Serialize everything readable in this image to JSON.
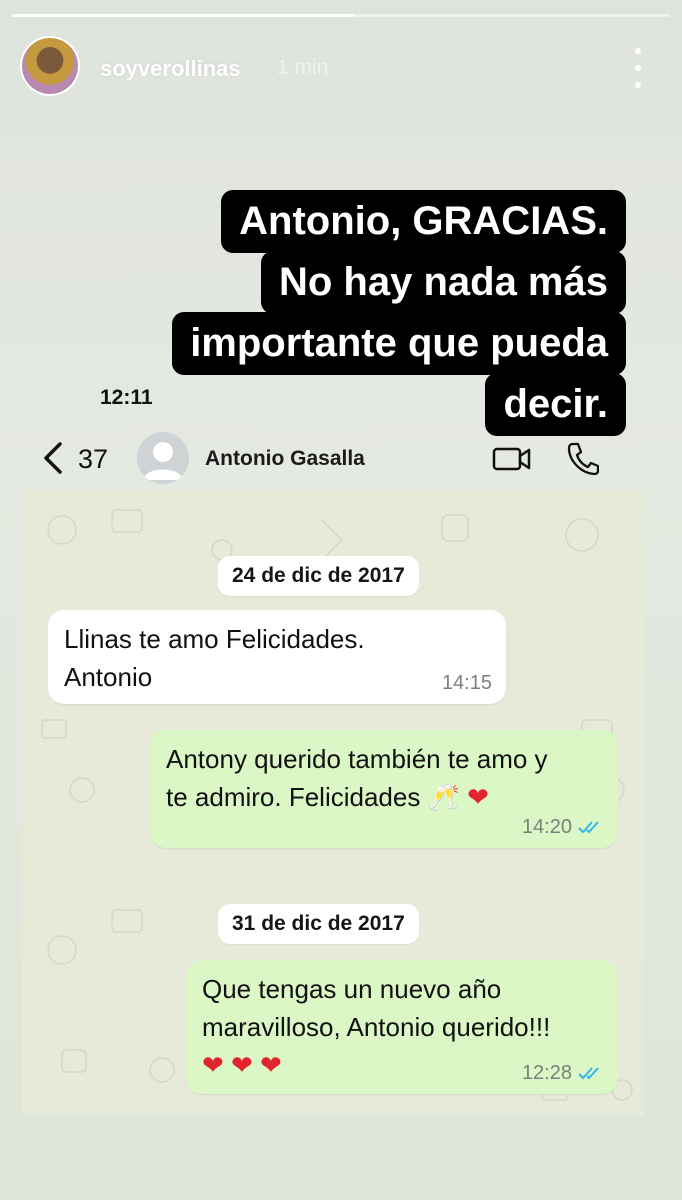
{
  "story": {
    "username": "soyverollinas",
    "time_ago": "1 min",
    "progress": 0.52
  },
  "caption": {
    "lines": [
      "Antonio, GRACIAS.",
      "No hay nada más",
      "importante que pueda",
      "decir."
    ]
  },
  "status_bar": {
    "clock": "12:11"
  },
  "chat_header": {
    "back_count": "37",
    "contact_name": "Antonio Gasalla",
    "icons": [
      "chevron-left-icon",
      "video-call-icon",
      "phone-icon"
    ]
  },
  "chat": {
    "date1": "24 de dic de 2017",
    "date2": "31 de dic de 2017",
    "messages": [
      {
        "direction": "in",
        "line1": "Llinas te amo Felicidades.",
        "line2": "Antonio",
        "time": "14:15"
      },
      {
        "direction": "out",
        "line1": "Antony querido también te amo y",
        "line2": "te admiro. Felicidades",
        "emoji": "🥂 ❤",
        "time": "14:20"
      },
      {
        "direction": "out",
        "line1": "Que tengas un nuevo año",
        "line2": "maravilloso, Antonio querido!!!",
        "emoji": "❤ ❤ ❤",
        "time": "12:28"
      }
    ]
  },
  "colors": {
    "caption_bg": "#000000",
    "incoming_bubble": "#ffffff",
    "outgoing_bubble": "#dcf7c6",
    "read_ticks": "#34b7f1",
    "heart": "#e1242d"
  }
}
